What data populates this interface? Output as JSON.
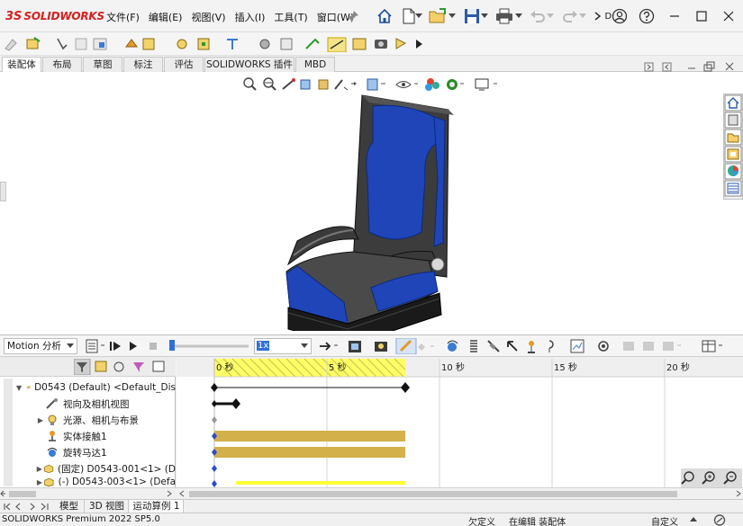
{
  "app": {
    "brand_ds": "3S",
    "brand": "SOLIDWORKS",
    "menu": [
      "文件(F)",
      "编辑(E)",
      "视图(V)",
      "插入(I)",
      "工具(T)",
      "窗口(W)"
    ],
    "search_label": "D"
  },
  "tabs": [
    "装配体",
    "布局",
    "草图",
    "标注",
    "评估",
    "SOLIDWORKS 插件",
    "MBD"
  ],
  "motion": {
    "study_type": "Motion 分析",
    "speed": "1x",
    "tree": [
      {
        "label": "D0543 (Default) <Default_Dis",
        "expand": "▼"
      },
      {
        "label": "视向及相机视图",
        "expand": ""
      },
      {
        "label": "光源、相机与布景",
        "expand": "▶"
      },
      {
        "label": "实体接触1",
        "expand": ""
      },
      {
        "label": "旋转马达1",
        "expand": ""
      },
      {
        "label": "(固定) D0543-001<1> (D",
        "expand": "▶"
      },
      {
        "label": "(-) D0543-003<1> (Defa",
        "expand": "▶"
      }
    ],
    "ticks": [
      "0 秒",
      "5 秒",
      "10 秒",
      "15 秒",
      "20 秒"
    ]
  },
  "bottom_tabs": [
    "模型",
    "3D 视图",
    "运动算例 1"
  ],
  "status": {
    "product": "SOLIDWORKS Premium 2022 SP5.0",
    "state": "欠定义",
    "editing": "在编辑 装配体",
    "units": "自定义"
  },
  "colors": {
    "seat_blue": "#1f45b8",
    "seat_frame": "#3c3c3c",
    "timeline_yellow": "#ffff66",
    "bar_gold": "#d3b04a",
    "brand_red": "#d42020"
  }
}
